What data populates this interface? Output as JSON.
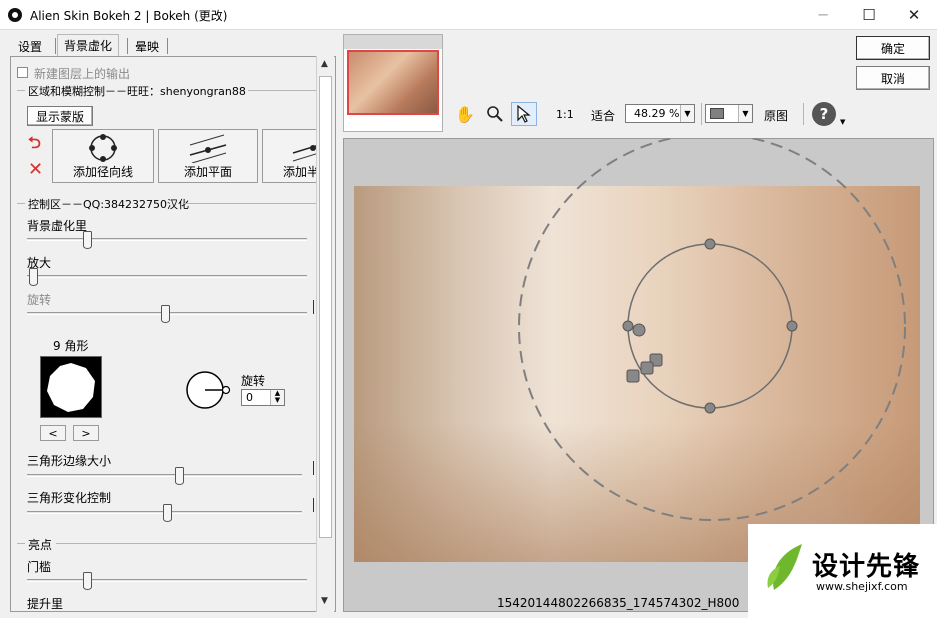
{
  "window": {
    "title": "Alien Skin Bokeh 2 | Bokeh (更改)",
    "min": "─",
    "max": "☐",
    "close": "✕"
  },
  "tabs": [
    {
      "label": "设置"
    },
    {
      "label": "背景虚化"
    },
    {
      "label": "晕映"
    }
  ],
  "left": {
    "new_layer_label": "新建图层上的输出",
    "region_group": "区域和模糊控制－－旺旺：shenyongran88",
    "show_mask": "显示蒙版",
    "add_radial": "添加径向线",
    "add_plane": "添加平面",
    "add_half": "添加半",
    "control_group": "控制区－－QQ:384232750汉化",
    "bg_blur_amount": "背景虚化里",
    "enlarge": "放大",
    "rotate": "旋转",
    "polygon_label": "9 角形",
    "prev": "<",
    "next": ">",
    "rotation_label": "旋转",
    "rotation_value": "0",
    "edge_size": "三角形边缘大小",
    "variation": "三角形变化控制",
    "highlights_group": "亮点",
    "threshold": "门槛",
    "boost": "提升里"
  },
  "toolbar": {
    "one_to_one": "1:1",
    "fit": "适合",
    "zoom": "48.29 %",
    "original": "原图"
  },
  "actions": {
    "ok": "确定",
    "cancel": "取消"
  },
  "preview": {
    "filename": "15420144802266835_174574302_H800"
  },
  "watermark": {
    "brand": "设计先锋",
    "url": "www.shejixf.com"
  },
  "colors": {
    "selection_border": "#e04646",
    "brand_green": "#6fb82d"
  }
}
